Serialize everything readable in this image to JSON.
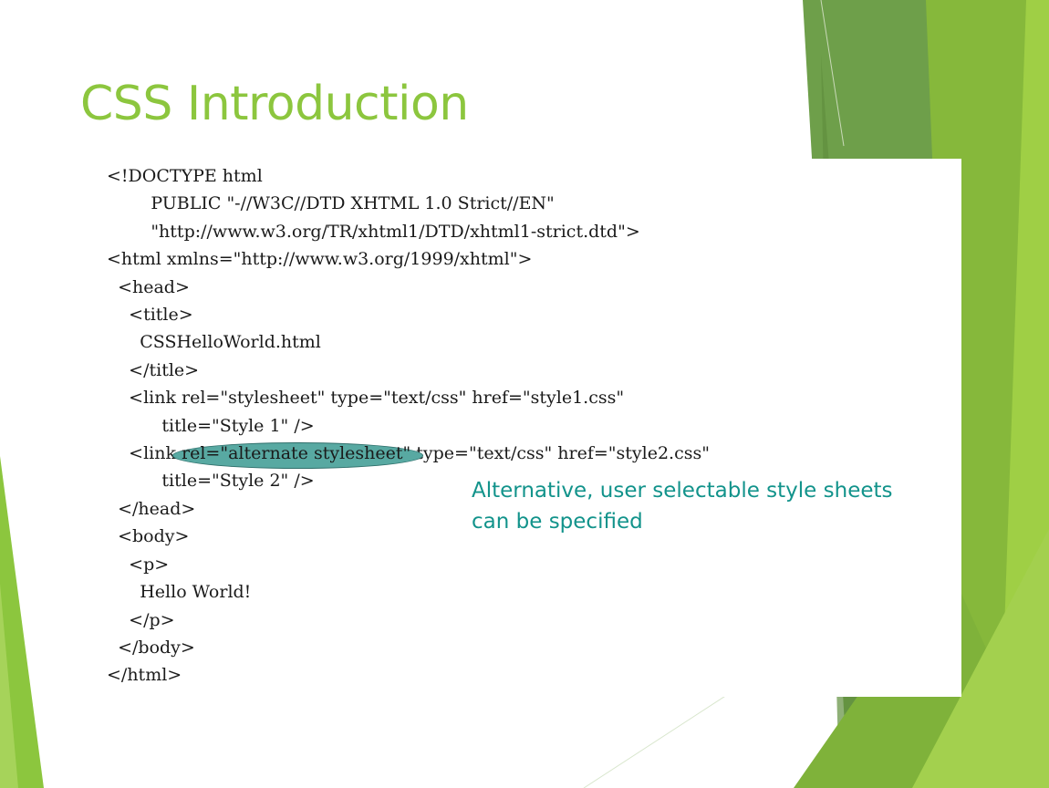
{
  "slide": {
    "title": "CSS Introduction",
    "colors": {
      "title": "#8cc63e",
      "accent_green": "#8cc63e",
      "dark_green": "#6e9f4a",
      "callout_text": "#12938b",
      "highlight_oval": "#58a9a2"
    }
  },
  "code": {
    "line1": "<!DOCTYPE html",
    "line2": "        PUBLIC \"-//W3C//DTD XHTML 1.0 Strict//EN\"",
    "line3": "        \"http://www.w3.org/TR/xhtml1/DTD/xhtml1-strict.dtd\">",
    "line4": "<html xmlns=\"http://www.w3.org/1999/xhtml\">",
    "line5": "  <head>",
    "line6": "    <title>",
    "line7": "      CSSHelloWorld.html",
    "line8": "    </title>",
    "line9": "    <link rel=\"stylesheet\" type=\"text/css\" href=\"style1.css\"",
    "line10": "          title=\"Style 1\" />",
    "line11_prefix": "    <link ",
    "line11_highlight": "rel=\"alternate stylesheet\"",
    "line11_suffix": " type=\"text/css\" href=\"style2.css\"",
    "line12": "          title=\"Style 2\" />",
    "line13": "  </head>",
    "line14": "  <body>",
    "line15": "    <p>",
    "line16": "      Hello World!",
    "line17": "    </p>",
    "line18": "  </body>",
    "line19": "</html>"
  },
  "callout": {
    "line1": "Alternative, user selectable style sheets",
    "line2": "can be specified"
  }
}
